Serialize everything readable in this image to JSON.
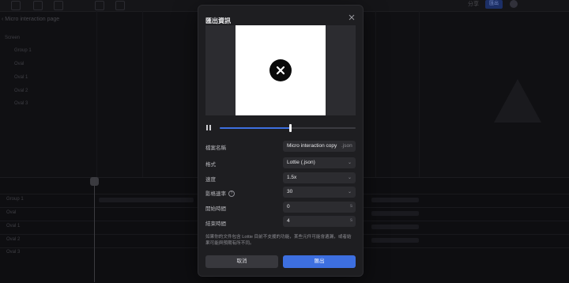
{
  "background": {
    "breadcrumb": "Micro interaction page",
    "top_right": [
      "分享"
    ],
    "top_right_button": "匯出",
    "layers": [
      "Screen",
      "Group 1",
      "Oval",
      "Oval 1",
      "Oval 2",
      "Oval 3"
    ],
    "timeline_layers": [
      "Group 1",
      "Oval",
      "Oval 1",
      "Oval 2",
      "Oval 3"
    ]
  },
  "modal": {
    "title": "匯出資訊",
    "close_icon": "close-icon",
    "preview": {
      "icon": "x-circle-icon",
      "playback_progress": 0.52
    },
    "pause_icon": "pause-icon",
    "fields": {
      "filename": {
        "label": "檔案名稱",
        "value": "Micro interaction copy",
        "suffix": ".json"
      },
      "format": {
        "label": "格式",
        "value": "Lottie (.json)"
      },
      "speed": {
        "label": "速度",
        "value": "1.5x"
      },
      "framerate": {
        "label": "影格速率",
        "value": "30"
      },
      "start_time": {
        "label": "開始時間",
        "value": "0",
        "unit": "s"
      },
      "end_time": {
        "label": "結束時間",
        "value": "4",
        "unit": "s"
      }
    },
    "note": "如果你的文件包含 Lottie 目前不支援的功能，某些元件可能會遺漏，或者結果可能與預期有所不同。",
    "cancel_label": "取消",
    "export_label": "匯出",
    "accent_color": "#3d6fe0"
  }
}
